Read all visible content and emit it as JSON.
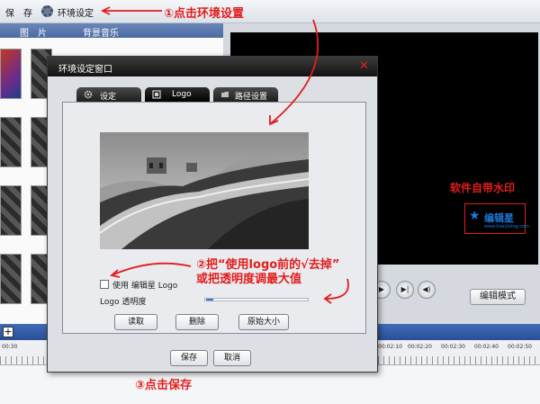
{
  "toolbar": {
    "save_label": "保",
    "store_label": "存",
    "env_label": "环境设定"
  },
  "left_panel": {
    "col_image": "图　片",
    "col_music": "背景音乐"
  },
  "preview": {
    "watermark_label": "软件自带水印",
    "watermark_logo_text": "编辑星",
    "watermark_url": "www.bianjixing.com",
    "edit_mode_label": "编辑模式"
  },
  "timeline": {
    "times": [
      "00:30",
      "00:02:10",
      "00:02:20",
      "00:02:30",
      "00:02:40",
      "00:02:50"
    ]
  },
  "dialog": {
    "title": "环境设定窗口",
    "close_glyph": "✕",
    "tabs": [
      {
        "label": "设定"
      },
      {
        "label": "Logo"
      },
      {
        "label": "路径设置"
      }
    ],
    "use_logo_label": "使用 编辑星 Logo",
    "use_logo_checked": false,
    "transparency_label": "Logo 透明度",
    "transparency_value": 0.07,
    "buttons": {
      "read": "读取",
      "delete": "删除",
      "original": "原始大小",
      "save": "保存",
      "cancel": "取消"
    }
  },
  "annotations": {
    "step1": "①点击环境设置",
    "step2_line1": "②把“使用logo前的√去掉”",
    "step2_line2": "或把透明度调最大值",
    "step3": "③点击保存"
  },
  "colors": {
    "annotation": "#e21d1d",
    "accent": "#2e7bd4",
    "title_bar": "#1a1a1a"
  },
  "icons": {
    "settings": "gear-icon",
    "logo_tab": "logo-tab-icon",
    "folder_tab": "folder-icon"
  }
}
